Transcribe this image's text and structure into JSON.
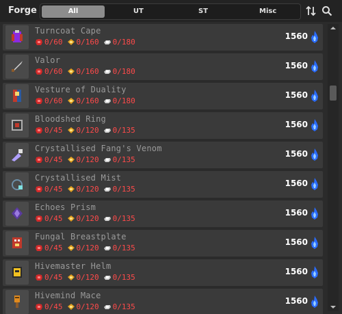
{
  "header": {
    "title": "Forge",
    "tabs": [
      "All",
      "UT",
      "ST",
      "Misc"
    ],
    "active_tab": "All",
    "sort_icon": "sort-arrows-icon",
    "search_icon": "search-icon"
  },
  "colors": {
    "cost_text": "#ff4a4a",
    "name_text": "#9a9a9a",
    "price_text": "#ffffff",
    "flame": "#2a6cff"
  },
  "cost_icons": [
    "red-essence-icon",
    "gold-essence-icon",
    "silver-essence-icon"
  ],
  "items": [
    {
      "name": "Turncoat Cape",
      "c1": "0/60",
      "c2": "0/160",
      "c3": "0/180",
      "price": "1560",
      "icon": "cape-icon"
    },
    {
      "name": "Valor",
      "c1": "0/60",
      "c2": "0/160",
      "c3": "0/180",
      "price": "1560",
      "icon": "sword-icon"
    },
    {
      "name": "Vesture of Duality",
      "c1": "0/60",
      "c2": "0/160",
      "c3": "0/180",
      "price": "1560",
      "icon": "robe-icon"
    },
    {
      "name": "Bloodshed Ring",
      "c1": "0/45",
      "c2": "0/120",
      "c3": "0/135",
      "price": "1560",
      "icon": "ring-icon"
    },
    {
      "name": "Crystallised Fang's Venom",
      "c1": "0/45",
      "c2": "0/120",
      "c3": "0/135",
      "price": "1560",
      "icon": "vial-icon"
    },
    {
      "name": "Crystallised Mist",
      "c1": "0/45",
      "c2": "0/120",
      "c3": "0/135",
      "price": "1560",
      "icon": "mist-icon"
    },
    {
      "name": "Echoes Prism",
      "c1": "0/45",
      "c2": "0/120",
      "c3": "0/135",
      "price": "1560",
      "icon": "prism-icon"
    },
    {
      "name": "Fungal Breastplate",
      "c1": "0/45",
      "c2": "0/120",
      "c3": "0/135",
      "price": "1560",
      "icon": "breastplate-icon"
    },
    {
      "name": "Hivemaster Helm",
      "c1": "0/45",
      "c2": "0/120",
      "c3": "0/135",
      "price": "1560",
      "icon": "helm-icon"
    },
    {
      "name": "Hivemind Mace",
      "c1": "0/45",
      "c2": "0/120",
      "c3": "0/135",
      "price": "1560",
      "icon": "mace-icon"
    }
  ]
}
